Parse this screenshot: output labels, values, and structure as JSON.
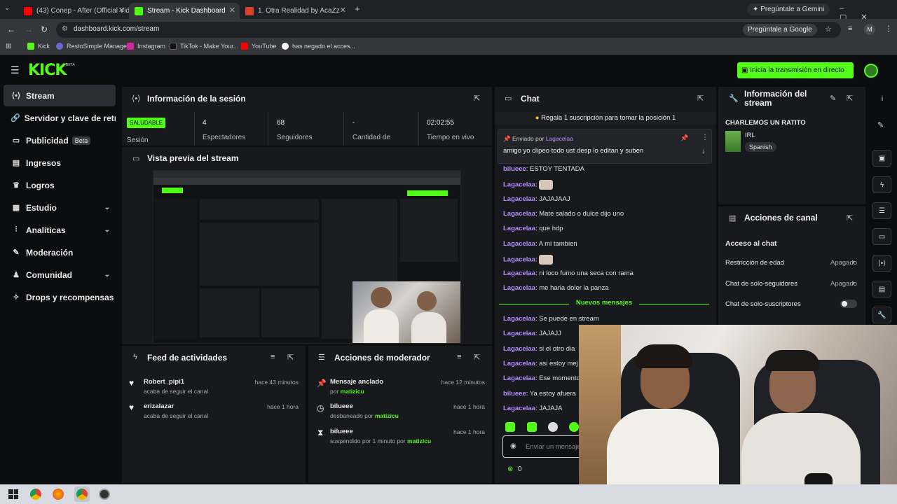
{
  "browser": {
    "tabs": [
      {
        "title": "(43) Conep - After (Official Vide",
        "color": "#ff0000"
      },
      {
        "title": "Stream - Kick Dashboard",
        "color": "#53fc18"
      },
      {
        "title": "1. Otra Realidad by AcaZz",
        "color": "#d9442a"
      }
    ],
    "new_tab": "+",
    "gemini": "Pregúntale a Gemini",
    "url": "dashboard.kick.com/stream",
    "ask_google": "Pregúntale a Google",
    "profile": "M",
    "bookmarks": [
      "Kick",
      "RestoSimple Manager",
      "Instagram",
      "TikTok - Make Your...",
      "YouTube",
      "has negado el acces..."
    ]
  },
  "kick": {
    "logo": "KICK",
    "logo_beta": "BETA",
    "go_live": "Inicia la transmisión en directo"
  },
  "sidebar": [
    {
      "label": "Stream",
      "icon": "broadcast-icon",
      "active": true
    },
    {
      "label": "Servidor y clave de retransmisión",
      "icon": "link-icon"
    },
    {
      "label": "Publicidad",
      "icon": "wallet-icon",
      "badge": "Beta"
    },
    {
      "label": "Ingresos",
      "icon": "ledger-icon"
    },
    {
      "label": "Logros",
      "icon": "trophy-icon"
    },
    {
      "label": "Estudio",
      "icon": "studio-icon",
      "chevron": true
    },
    {
      "label": "Analíticas",
      "icon": "chart-icon",
      "chevron": true
    },
    {
      "label": "Moderación",
      "icon": "wrench-icon"
    },
    {
      "label": "Comunidad",
      "icon": "community-icon",
      "chevron": true
    },
    {
      "label": "Drops y recompensas",
      "icon": "gift-icon"
    }
  ],
  "session": {
    "title": "Información de la sesión",
    "status": "SALUDABLE",
    "status_label": "Sesión",
    "stats": [
      {
        "value": "4",
        "label": "Espectadores"
      },
      {
        "value": "68",
        "label": "Seguidores"
      },
      {
        "value": "-",
        "label": "Cantidad de"
      },
      {
        "value": "02:02:55",
        "label": "Tiempo en vivo"
      }
    ]
  },
  "preview": {
    "title": "Vista previa del stream"
  },
  "activity": {
    "title": "Feed de actividades",
    "items": [
      {
        "user": "Robert_pipi1",
        "text": "acaba de seguir el canal",
        "time": "hace 43 minutos"
      },
      {
        "user": "erizalazar",
        "text": "acaba de seguir el canal",
        "time": "hace 1 hora"
      }
    ]
  },
  "modactions": {
    "title": "Acciones de moderador",
    "items": [
      {
        "title": "Mensaje anclado",
        "pre": "por",
        "by": "matizicu",
        "time": "hace 12 minutos",
        "icon": "pin-icon"
      },
      {
        "title": "bilueee",
        "pre": "desbaneado por",
        "by": "matizicu",
        "time": "hace 1 hora",
        "icon": "clock-icon"
      },
      {
        "title": "bilueee",
        "pre": "suspendido por 1 minuto por",
        "by": "matizicu",
        "time": "hace 1 hora",
        "icon": "hourglass-icon"
      }
    ]
  },
  "chat": {
    "title": "Chat",
    "gift_banner": "Regala 1 suscripción para tomar la posición 1",
    "pinned": {
      "label": "Enviado por",
      "author": "Lagacelaa",
      "text": "amigo yo clipeo todo ust desp lo editan y suben"
    },
    "messages": [
      {
        "user": "bilueee",
        "text": "ESTOY TENTADA"
      },
      {
        "user": "Lagacelaa",
        "text": ""
      },
      {
        "user": "Lagacelaa",
        "text": "JAJAJAAJ"
      },
      {
        "user": "Lagacelaa",
        "text": "Mate salado o dulce dijo uno"
      },
      {
        "user": "Lagacelaa",
        "text": "que hdp"
      },
      {
        "user": "Lagacelaa",
        "text": "A mi tambien"
      },
      {
        "user": "Lagacelaa",
        "text": ""
      },
      {
        "user": "Lagacelaa",
        "text": "ni loco fumo una seca con rama"
      },
      {
        "user": "Lagacelaa",
        "text": "me haria doler la panza"
      }
    ],
    "new_messages": "Nuevos mensajes",
    "messages2": [
      {
        "user": "Lagacelaa",
        "text": "Se puede en stream"
      },
      {
        "user": "Lagacelaa",
        "text": "JAJAJJ"
      },
      {
        "user": "Lagacelaa",
        "text": "si el otro dia"
      },
      {
        "user": "Lagacelaa",
        "text": "asi estoy mej"
      },
      {
        "user": "Lagacelaa",
        "text": "Ese momento"
      },
      {
        "user": "bilueee",
        "text": "Ya estoy afuera"
      },
      {
        "user": "Lagacelaa",
        "text": "JAJAJA"
      }
    ],
    "placeholder": "Enviar un mensaje",
    "count": "0"
  },
  "streaminfo": {
    "title": "Información del stream",
    "stream_title": "CHARLEMOS UN RATITO",
    "category": "IRL",
    "language": "Spanish"
  },
  "channel": {
    "title": "Acciones de canal",
    "section": "Acceso al chat",
    "rows": [
      {
        "label": "Restricción de edad",
        "value": "Apagado"
      },
      {
        "label": "Chat de solo-seguidores",
        "value": "Apagado"
      },
      {
        "label": "Chat de solo-suscriptores",
        "value": ""
      }
    ]
  },
  "colors": {
    "accent": "#53fc18",
    "username": "#b58cff",
    "panel": "#18191c"
  }
}
